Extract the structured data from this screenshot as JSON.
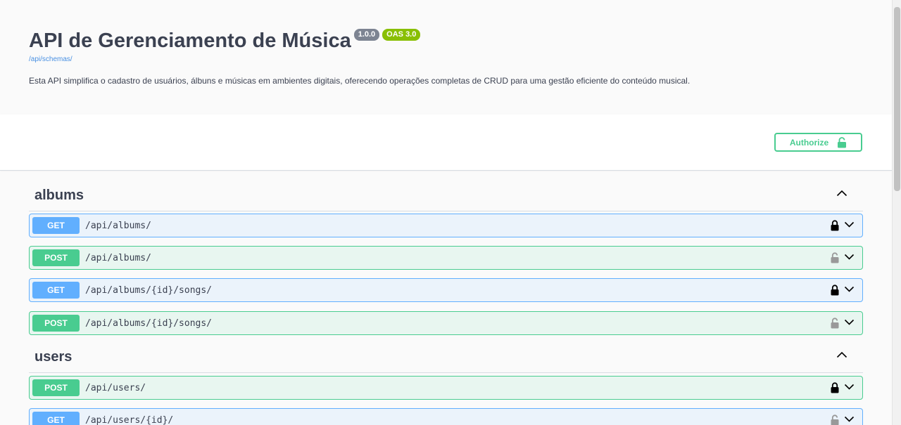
{
  "info": {
    "title": "API de Gerenciamento de Música",
    "version": "1.0.0",
    "oas": "OAS 3.0",
    "schema_link": "/api/schemas/",
    "description": "Esta API simplifica o cadastro de usuários, álbuns e músicas em ambientes digitais, oferecendo operações completas de CRUD para uma gestão eficiente do conteúdo musical."
  },
  "authorize": {
    "label": "Authorize"
  },
  "tags": [
    {
      "name": "albums",
      "operations": [
        {
          "method": "GET",
          "path": "/api/albums/",
          "locked": true
        },
        {
          "method": "POST",
          "path": "/api/albums/",
          "locked": false
        },
        {
          "method": "GET",
          "path": "/api/albums/{id}/songs/",
          "locked": true
        },
        {
          "method": "POST",
          "path": "/api/albums/{id}/songs/",
          "locked": false
        }
      ]
    },
    {
      "name": "users",
      "operations": [
        {
          "method": "POST",
          "path": "/api/users/",
          "locked": true
        },
        {
          "method": "GET",
          "path": "/api/users/{id}/",
          "locked": false
        }
      ]
    }
  ],
  "colors": {
    "get": "#61affe",
    "post": "#49cc90",
    "text": "#3b4151",
    "badge_version": "#7d8492",
    "badge_oas": "#89bf04",
    "link": "#4990e2"
  }
}
